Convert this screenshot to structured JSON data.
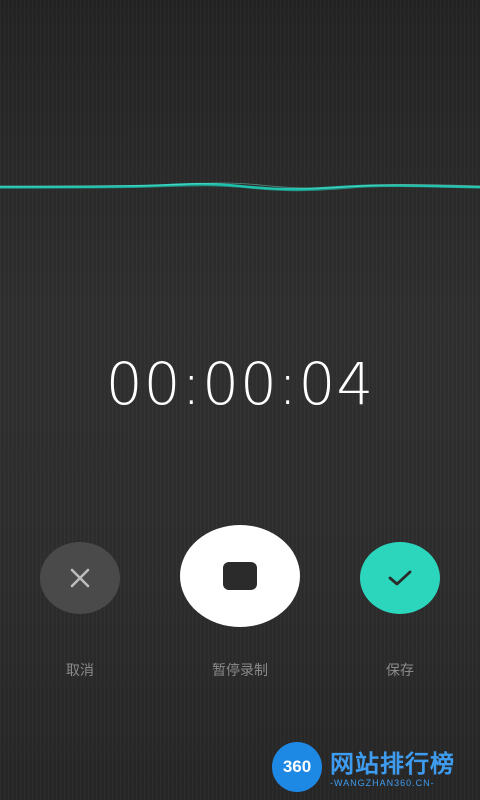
{
  "recorder": {
    "elapsed_time": "00:00:04",
    "status": "recording"
  },
  "controls": {
    "cancel_label": "取消",
    "pause_label": "暂停录制",
    "save_label": "保存"
  },
  "icons": {
    "cancel": "close-icon",
    "stop": "stop-icon",
    "save": "checkmark-icon"
  },
  "colors": {
    "accent": "#2bd6bd",
    "waveform": "#1fc9b4",
    "cancel_button": "#4a4a4a",
    "stop_button": "#ffffff",
    "label_text": "#8a8a8a"
  },
  "watermark": {
    "badge": "360",
    "title": "网站排行榜",
    "subtitle": "-WANGZHAN360.CN-"
  }
}
